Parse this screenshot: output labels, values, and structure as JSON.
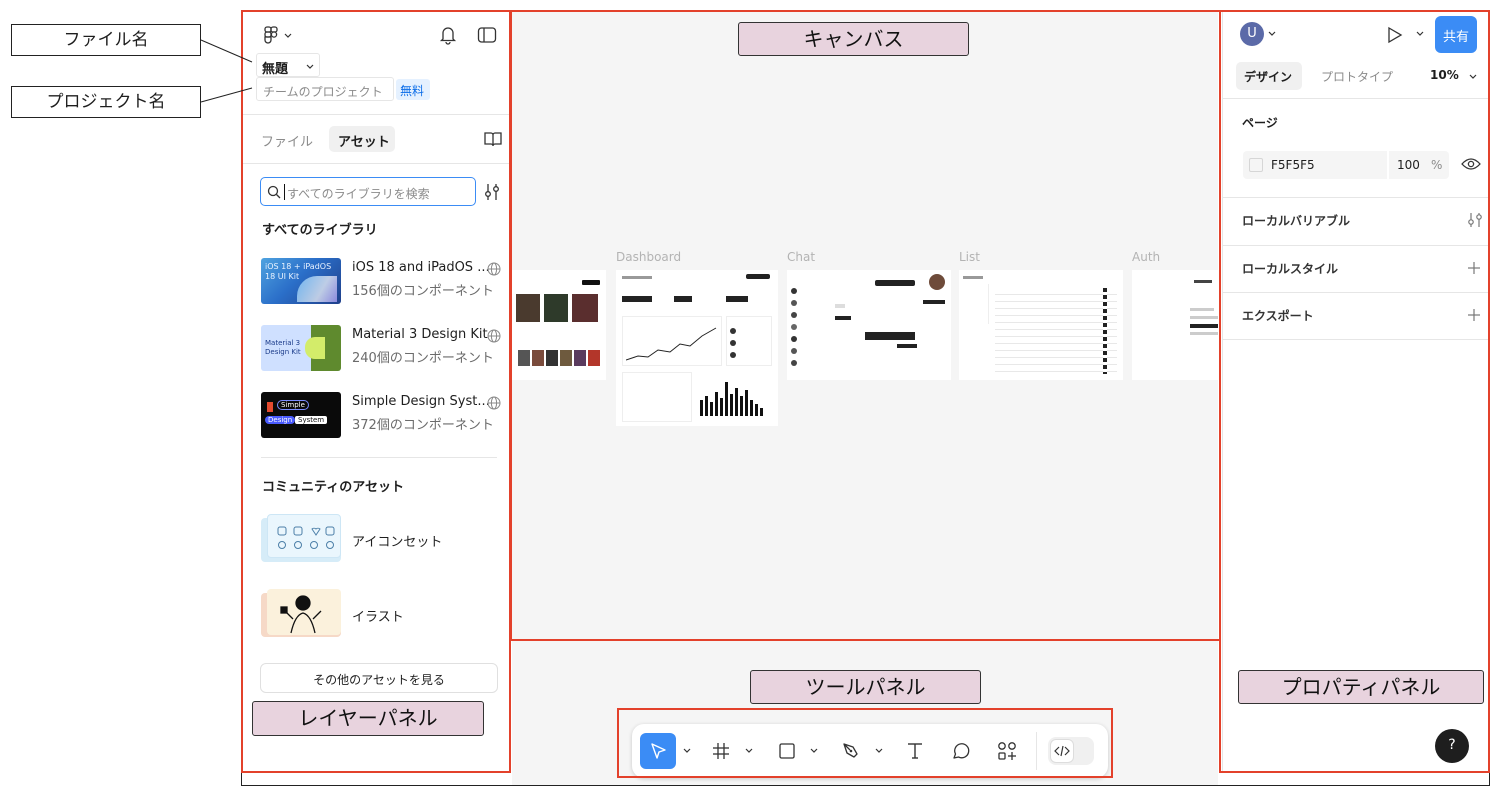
{
  "annotations": {
    "file_name": "ファイル名",
    "project_name": "プロジェクト名",
    "canvas": "キャンバス",
    "tool_panel": "ツールパネル",
    "layer_panel": "レイヤーパネル",
    "property_panel": "プロパティパネル"
  },
  "file": {
    "title": "無題",
    "project": "チームのプロジェクト",
    "plan_badge": "無料"
  },
  "left_tabs": {
    "files": "ファイル",
    "assets": "アセット"
  },
  "search": {
    "placeholder": "すべてのライブラリを検索"
  },
  "libraries": {
    "heading": "すべてのライブラリ",
    "items": [
      {
        "name": "iOS 18 and iPadOS ...",
        "count": "156個のコンポーネント",
        "thumb_text": "iOS 18 + iPadOS 18 UI Kit"
      },
      {
        "name": "Material 3 Design Kit",
        "count": "240個のコンポーネント",
        "thumb_text": "Material 3 Design Kit"
      },
      {
        "name": "Simple Design Syst...",
        "count": "372個のコンポーネント",
        "thumb_text_1": "Simple",
        "thumb_text_2": "Design",
        "thumb_text_3": "System"
      }
    ]
  },
  "community": {
    "heading": "コミュニティのアセット",
    "items": [
      {
        "name": "アイコンセット"
      },
      {
        "name": "イラスト"
      }
    ],
    "more_button": "その他のアセットを見る"
  },
  "canvas_frames": [
    {
      "label": "Dashboard"
    },
    {
      "label": "Chat"
    },
    {
      "label": "List"
    },
    {
      "label": "Auth"
    }
  ],
  "right_panel": {
    "avatar_letter": "U",
    "share_button": "共有",
    "tabs": {
      "design": "デザイン",
      "prototype": "プロトタイプ"
    },
    "zoom": "10%",
    "page_heading": "ページ",
    "page_color": "F5F5F5",
    "page_opacity": "100",
    "page_opacity_unit": "%",
    "local_variables": "ローカルバリアブル",
    "local_styles": "ローカルスタイル",
    "export": "エクスポート",
    "help": "?"
  },
  "colors": {
    "annotation_border": "#e3412b",
    "annotation_label_bg": "#e8d3de",
    "accent_blue": "#3b8cf5",
    "canvas_bg": "#f5f5f5"
  },
  "icons": [
    "figma-menu-icon",
    "bell-icon",
    "sidebar-toggle-icon",
    "library-book-icon",
    "search-icon",
    "filter-icon",
    "globe-icon",
    "play-icon",
    "chevron-down-icon",
    "eye-icon",
    "plus-icon",
    "move-tool-icon",
    "frame-tool-icon",
    "shape-tool-icon",
    "pen-tool-icon",
    "text-tool-icon",
    "comment-tool-icon",
    "actions-icon",
    "dev-mode-icon",
    "help-icon"
  ]
}
